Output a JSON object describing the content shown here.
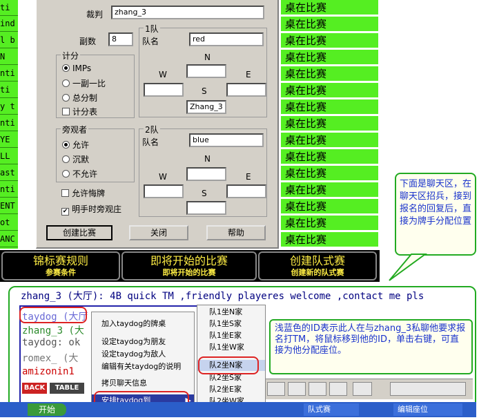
{
  "left_strip": [
    "ti",
    "ind",
    "l b",
    "N",
    "nti",
    "ti",
    "y t",
    "nti",
    "YE",
    "LL",
    "ast",
    "nti",
    "ENT",
    "ot",
    "ANC"
  ],
  "status_col": {
    "rows": [
      "桌在比赛",
      "桌在比赛",
      "桌在比赛",
      "桌在比赛",
      "桌在比赛",
      "桌在比赛",
      "桌在比赛",
      "桌在比赛",
      "桌在比赛",
      "桌在比赛",
      "桌在比赛",
      "桌在比赛",
      "桌在比赛",
      "桌在比赛",
      "桌在比赛"
    ]
  },
  "dialog": {
    "referee_label": "裁判",
    "referee_value": "zhang_3",
    "boards_label": "副数",
    "boards_value": "8",
    "scoring": {
      "title": "计分",
      "options": [
        "IMPs",
        "一副一比",
        "总分制"
      ],
      "selected": 0,
      "scoresheet_label": "计分表"
    },
    "spectators": {
      "title": "旁观者",
      "options": [
        "允许",
        "沉默",
        "不允许"
      ],
      "selected": 0
    },
    "allow_undo_label": "允许悔牌",
    "open_dummy_label": "明手时旁观庄",
    "team1": {
      "title": "1队",
      "name_label": "队名",
      "name_value": "red",
      "n": "N",
      "w": "W",
      "e": "E",
      "s": "S",
      "s_value": "Zhang_3"
    },
    "team2": {
      "title": "2队",
      "name_label": "队名",
      "name_value": "blue",
      "n": "N",
      "w": "W",
      "e": "E",
      "s": "S"
    },
    "create_button": "创建比赛",
    "close_button": "关闭",
    "help_button": "帮助"
  },
  "tabs": [
    {
      "main": "锦标赛规则",
      "sub": "参赛条件"
    },
    {
      "main": "即将开始的比赛",
      "sub": "即将开始的比赛"
    },
    {
      "main": "创建队式赛",
      "sub": "创建新的队式赛"
    }
  ],
  "callout_top": "下面是聊天区，在聊天区招兵，接到报名的回复后，直接为牌手分配位置",
  "chat": {
    "top_line": "zhang_3 (大厅): 4B quick TM ,friendly playeres welcome ,contact me pls",
    "lines": [
      "taydog (大厅",
      ":",
      "zhang_3 (大",
      "taydog: ok",
      "romex_ (大",
      "amizonin1"
    ],
    "buttons": [
      "BACK",
      "TABLE"
    ]
  },
  "context_menu": {
    "items": [
      "加入taydog的牌桌",
      "设定taydog为朋友",
      "设定taydog为敌人",
      "编辑有关taydog的说明",
      "拷贝聊天信息",
      "安排taydog到"
    ],
    "arrow": "▶"
  },
  "submenu": {
    "items": [
      "队1坐N家",
      "队1坐S家",
      "队1坐E家",
      "队1坐W家",
      "队2坐N家",
      "队2坐S家",
      "队2坐E家",
      "队2坐W家"
    ],
    "highlight": 4
  },
  "callout_mid": "浅蓝色的ID表示此人在与zhang_3私聊他要求报名打TM，将鼠标移到他的ID，单击右键，可直接为他分配座位。",
  "taskbar": {
    "start": "开始",
    "item1": "队式赛",
    "item2": "编辑座位"
  },
  "colors": {
    "green": "#55ee22",
    "tab_text": "#ffee44",
    "callout_text": "#1a33cc",
    "oval": "#dd2222"
  }
}
